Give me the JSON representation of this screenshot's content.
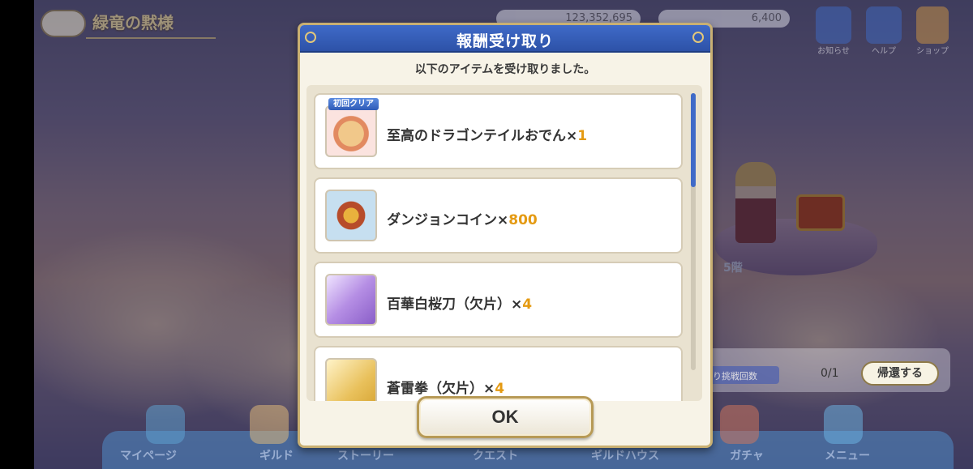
{
  "header": {
    "stage_title": "緑竜の黙様",
    "currency_1": "123,352,695",
    "currency_2": "6,400",
    "icon_labels": [
      "お知らせ",
      "ヘルプ",
      "ショップ"
    ]
  },
  "stage": {
    "floor_label": "5階",
    "challenge_tag": "り挑戦回数",
    "challenge_count": "0/1",
    "return_button": "帰還する"
  },
  "bottom_nav": [
    "マイページ",
    "ギルド",
    "ストーリー",
    "クエスト",
    "ギルドハウス",
    "ガチャ",
    "メニュー"
  ],
  "dialog": {
    "title": "報酬受け取り",
    "subtitle": "以下のアイテムを受け取りました。",
    "ok_label": "OK",
    "items": [
      {
        "name": "至高のドラゴンテイルおでん×",
        "qty": "1",
        "badge": "初回クリア",
        "icon": "oden-icon"
      },
      {
        "name": "ダンジョンコイン×",
        "qty": "800",
        "badge": "",
        "icon": "dungeon-coin-icon"
      },
      {
        "name": "百華白桜刀（欠片）×",
        "qty": "4",
        "badge": "",
        "icon": "sword-fragment-icon"
      },
      {
        "name": "蒼雷拳（欠片）×",
        "qty": "4",
        "badge": "",
        "icon": "fist-fragment-icon"
      }
    ]
  },
  "colors": {
    "dialog_header": "#3f6ac8",
    "quantity": "#e49a12",
    "border_gold": "#c9b072"
  }
}
